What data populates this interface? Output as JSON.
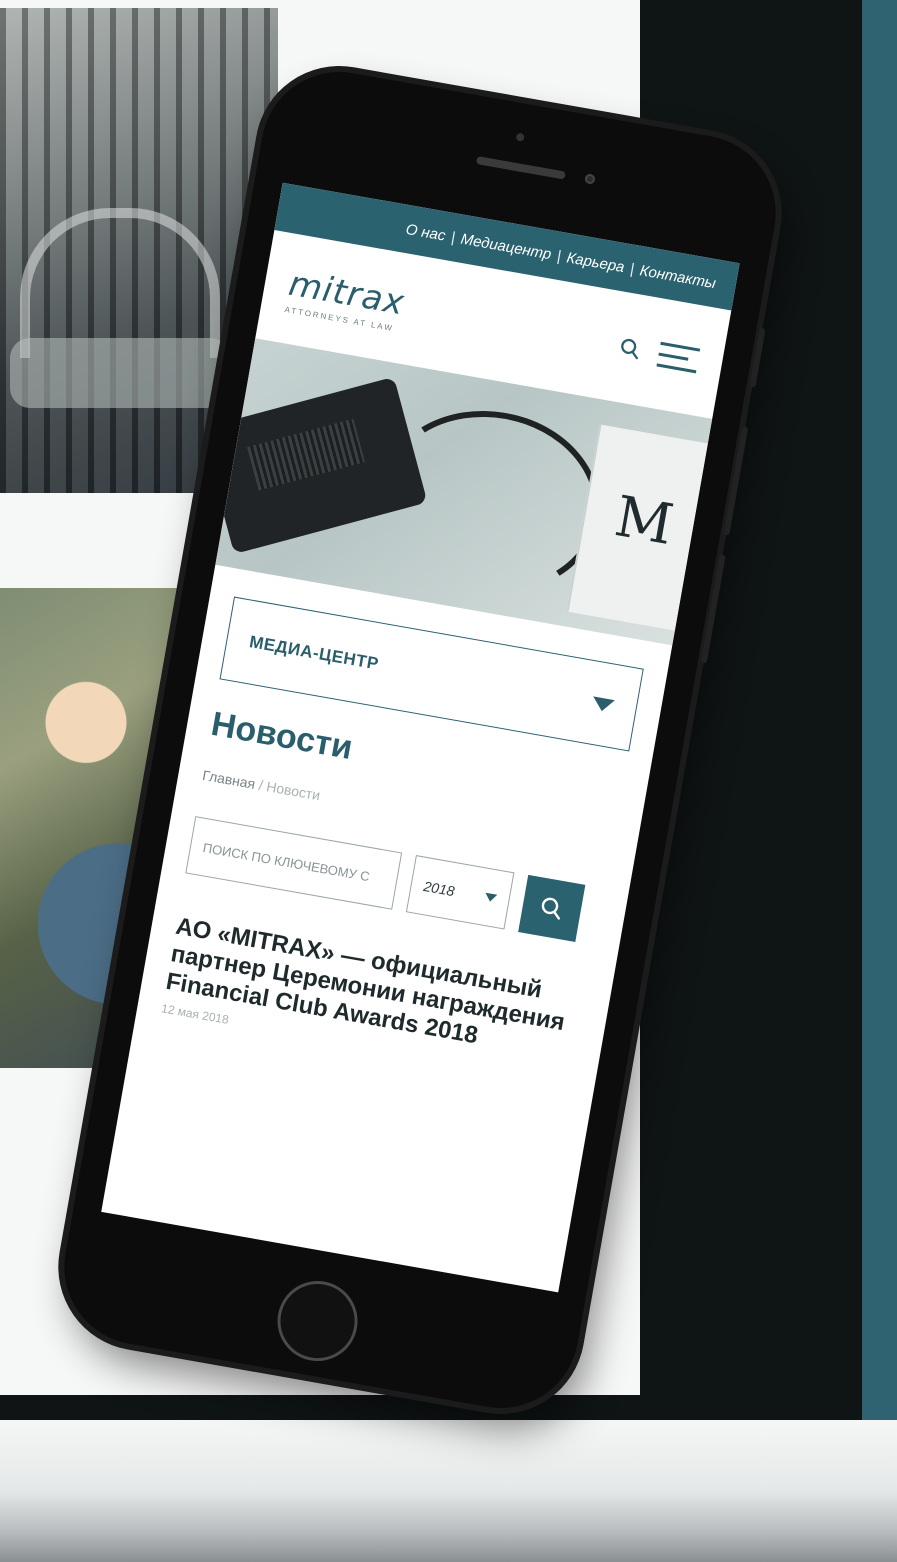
{
  "topnav": {
    "items": [
      "О нас",
      "Медиацентр",
      "Карьера",
      "Контакты"
    ],
    "separator": "|"
  },
  "header": {
    "logo": "mitrax",
    "tagline": "ATTORNEYS AT LAW",
    "icons": [
      "search-icon",
      "menu-icon"
    ]
  },
  "hero": {
    "letter": "M"
  },
  "section_dropdown": {
    "label": "МЕДИА-ЦЕНТР"
  },
  "page": {
    "title": "Новости"
  },
  "breadcrumb": {
    "home": "Главная",
    "separator": "/",
    "current": "Новости"
  },
  "filters": {
    "keyword_placeholder": "ПОИСК ПО КЛЮЧЕВОМУ С",
    "year_value": "2018"
  },
  "news": [
    {
      "title": "АО «MITRAX» — официальный партнер Церемонии награждения Financial Club Awards 2018",
      "date": "12 мая 2018"
    }
  ],
  "colors": {
    "brand": "#2b6270",
    "brand_text": "#2b5e6c",
    "side_panel": "#2f6372"
  }
}
